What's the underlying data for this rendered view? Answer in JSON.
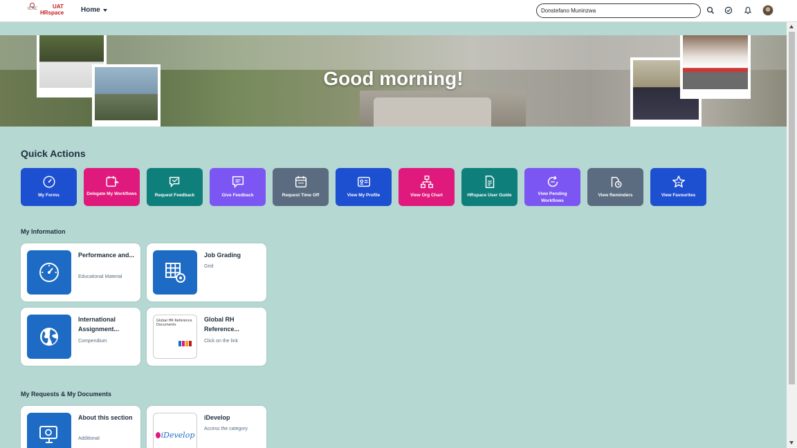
{
  "header": {
    "logo_mark": "ICRC",
    "logo_uat": "UAT",
    "logo_app": "HRspace",
    "home_label": "Home",
    "search_value": "Donstefano Muninzwa",
    "icons": [
      "search-icon",
      "check-circle-icon",
      "bell-icon",
      "avatar"
    ]
  },
  "banner": {
    "greeting": "Good morning!"
  },
  "quick_actions": {
    "title": "Quick Actions",
    "items": [
      {
        "label": "My Forms",
        "color": "#1d4fd1",
        "icon": "gauge-icon"
      },
      {
        "label": "Delegate My Workflows",
        "color": "#e0197d",
        "icon": "calendar-arrow-icon"
      },
      {
        "label": "Request Feedback",
        "color": "#0f7f7c",
        "icon": "feedback-icon"
      },
      {
        "label": "Give Feedback",
        "color": "#7b56f2",
        "icon": "comment-icon"
      },
      {
        "label": "Request Time Off",
        "color": "#5b6b80",
        "icon": "calendar-icon"
      },
      {
        "label": "View My Profile",
        "color": "#1d4fd1",
        "icon": "id-card-icon"
      },
      {
        "label": "View Org Chart",
        "color": "#e0197d",
        "icon": "org-chart-icon"
      },
      {
        "label": "HRspace User Guide",
        "color": "#0f7f7c",
        "icon": "document-icon"
      },
      {
        "label": "View Pending Workflows",
        "color": "#7b56f2",
        "icon": "refresh-icon"
      },
      {
        "label": "View Reminders",
        "color": "#5b6b80",
        "icon": "reminder-icon"
      },
      {
        "label": "View Favourites",
        "color": "#1d4fd1",
        "icon": "star-icon"
      }
    ]
  },
  "my_information": {
    "title": "My Information",
    "tiles": [
      {
        "title": "Performance and...",
        "subtitle": "Educational Material",
        "icon": "gauge-icon"
      },
      {
        "title": "Job Grading",
        "subtitle": "Grid",
        "icon": "grid-gear-icon"
      },
      {
        "title": "International Assignment...",
        "subtitle": "Compendium",
        "icon": "globe-icon"
      },
      {
        "title": "Global RH Reference...",
        "subtitle": "Click on the link",
        "icon": "document-thumbnail",
        "thumb_text": "Global HR Reference Documents"
      }
    ]
  },
  "my_requests": {
    "title": "My Requests & My Documents",
    "tiles": [
      {
        "title": "About this section",
        "subtitle": "Additional",
        "icon": "monitor-icon"
      },
      {
        "title": "iDevelop",
        "subtitle": "Access the category",
        "icon": "idevelop-logo",
        "logo_text": "iDevelop"
      }
    ]
  }
}
